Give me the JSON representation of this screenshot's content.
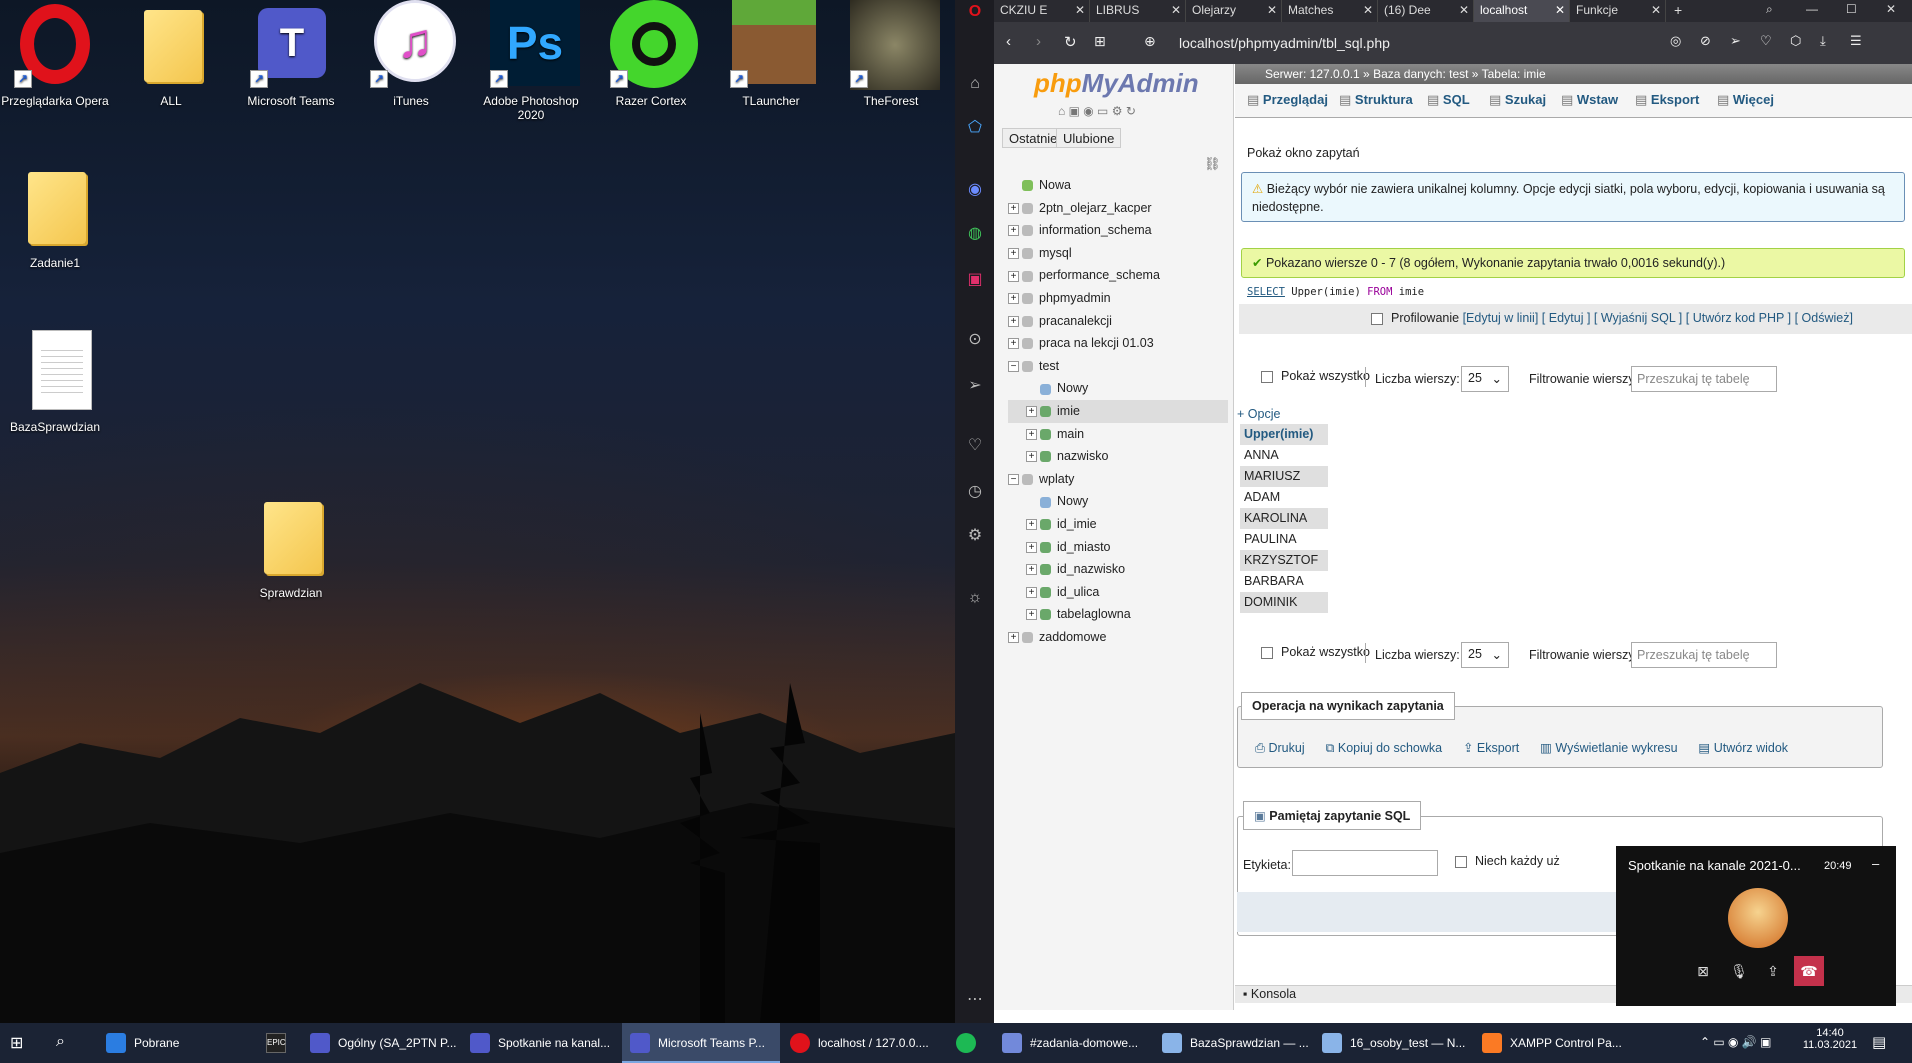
{
  "desktop": {
    "icons": [
      {
        "label": "Przeglądarka Opera"
      },
      {
        "label": "ALL"
      },
      {
        "label": "Microsoft Teams"
      },
      {
        "label": "iTunes"
      },
      {
        "label": "Adobe Photoshop 2020"
      },
      {
        "label": "Razer Cortex"
      },
      {
        "label": "TLauncher"
      },
      {
        "label": "TheForest"
      },
      {
        "label": "Zadanie1"
      },
      {
        "label": "BazaSprawdzian"
      },
      {
        "label": "Sprawdzian"
      }
    ]
  },
  "browser": {
    "tabs": [
      {
        "label": "CKZIU E"
      },
      {
        "label": "LIBRUS"
      },
      {
        "label": "Olejarzy"
      },
      {
        "label": "Matches"
      },
      {
        "label": "(16) Dee"
      },
      {
        "label": "localhost"
      },
      {
        "label": "Funkcje"
      }
    ],
    "url": "localhost/phpmyadmin/tbl_sql.php"
  },
  "pma": {
    "logo_php": "php",
    "logo_my": "MyAdmin",
    "nav_tabs": [
      "Ostatnie",
      "Ulubione"
    ],
    "tree": [
      "Nowa",
      "2ptn_olejarz_kacper",
      "information_schema",
      "mysql",
      "performance_schema",
      "phpmyadmin",
      "pracanalekcji",
      "praca na lekcji 01.03",
      "test",
      "Nowy",
      "imie",
      "main",
      "nazwisko",
      "wplaty",
      "Nowy",
      "id_imie",
      "id_miasto",
      "id_nazwisko",
      "id_ulica",
      "tabelaglowna",
      "zaddomowe"
    ],
    "breadcrumb": {
      "server": "Serwer: 127.0.0.1 »",
      "db": "Baza danych: test »",
      "table": "Tabela: imie"
    },
    "menu": [
      "Przeglądaj",
      "Struktura",
      "SQL",
      "Szukaj",
      "Wstaw",
      "Eksport",
      "Więcej"
    ],
    "show_query": "Pokaż okno zapytań",
    "warning": "Bieżący wybór nie zawiera unikalnej kolumny. Opcje edycji siatki, pola wyboru, edycji, kopiowania i usuwania są niedostępne.",
    "success": "Pokazano wiersze 0 - 7 (8 ogółem, Wykonanie zapytania trwało 0,0016 sekund(y).)",
    "sql": {
      "kw1": "SELECT",
      "fn": "Upper(imie)",
      "kw2": "FROM",
      "tbl": "imie"
    },
    "profiling": {
      "label": "Profilowanie",
      "links": [
        "[Edytuj w linii]",
        "[ Edytuj ]",
        "[ Wyjaśnij SQL ]",
        "[ Utwórz kod PHP ]",
        "[ Odśwież]"
      ]
    },
    "controls": {
      "show_all": "Pokaż wszystko",
      "rows_label": "Liczba wierszy:",
      "rows_value": "25",
      "filter_label": "Filtrowanie wierszy:",
      "filter_placeholder": "Przeszukaj tę tabelę"
    },
    "options": "+ Opcje",
    "result": {
      "header": "Upper(imie)",
      "rows": [
        "ANNA",
        "MARIUSZ",
        "ADAM",
        "KAROLINA",
        "PAULINA",
        "KRZYSZTOF",
        "BARBARA",
        "DOMINIK"
      ]
    },
    "ops": {
      "title": "Operacja na wynikach zapytania",
      "items": [
        "Drukuj",
        "Kopiuj do schowka",
        "Eksport",
        "Wyświetlanie wykresu",
        "Utwórz widok"
      ]
    },
    "bookmark": {
      "title": "Pamiętaj zapytanie SQL",
      "label": "Etykieta:",
      "every_user": "Niech każdy uż"
    },
    "console": "Konsola"
  },
  "teams_popup": {
    "title": "Spotkanie na kanale 2021-0...",
    "time": "20:49"
  },
  "taskbar": {
    "items": [
      "Pobrane",
      "Ogólny (SA_2PTN P...",
      "Spotkanie na kanal...",
      "Microsoft Teams P...",
      "localhost / 127.0.0....",
      "#zadania-domowe...",
      "BazaSprawdzian — ...",
      "16_osoby_test — N...",
      "XAMPP Control Pa..."
    ],
    "time": "14:40",
    "date": "11.03.2021"
  }
}
